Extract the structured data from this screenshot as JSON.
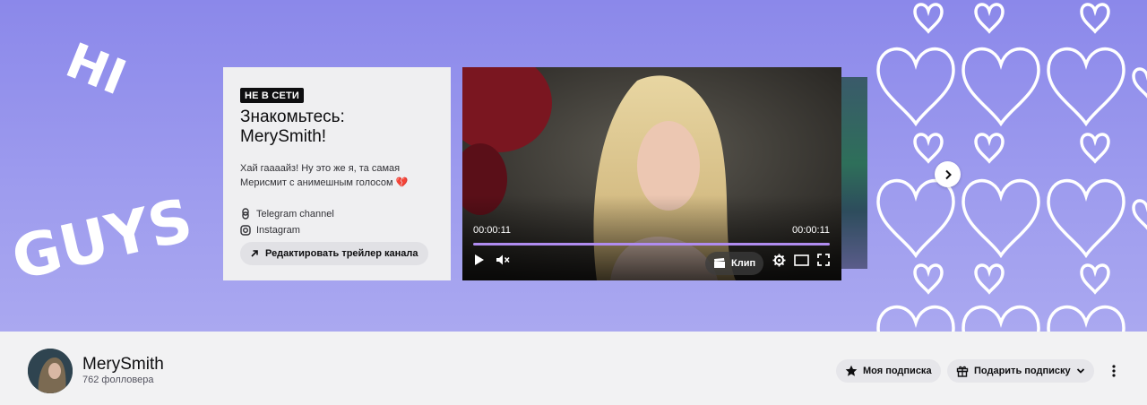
{
  "banner": {
    "hi_text": "HI",
    "guys_text": "GUYS",
    "background_color": "#8b88ea",
    "heart_color": "#ffffff"
  },
  "info_card": {
    "status_badge": "НЕ В СЕТИ",
    "title": "Знакомьтесь: MerySmith!",
    "description": "Хай гаааайз! Ну это же я, та самая Мерисмит с анимешным голосом 💔",
    "links": [
      {
        "icon": "telegram-link-icon",
        "label": "Telegram channel"
      },
      {
        "icon": "instagram-icon",
        "label": "Instagram"
      }
    ],
    "edit_trailer_label": "Редактировать трейлер канала"
  },
  "player": {
    "time_current": "00:00:11",
    "time_total": "00:00:11",
    "progress": 1.0,
    "clip_label": "Клип",
    "accent_color": "#b08cf0"
  },
  "profile": {
    "channel_name": "MerySmith",
    "followers": "762 фолловера",
    "subscription_label": "Моя подписка",
    "gift_label": "Подарить подписку"
  }
}
